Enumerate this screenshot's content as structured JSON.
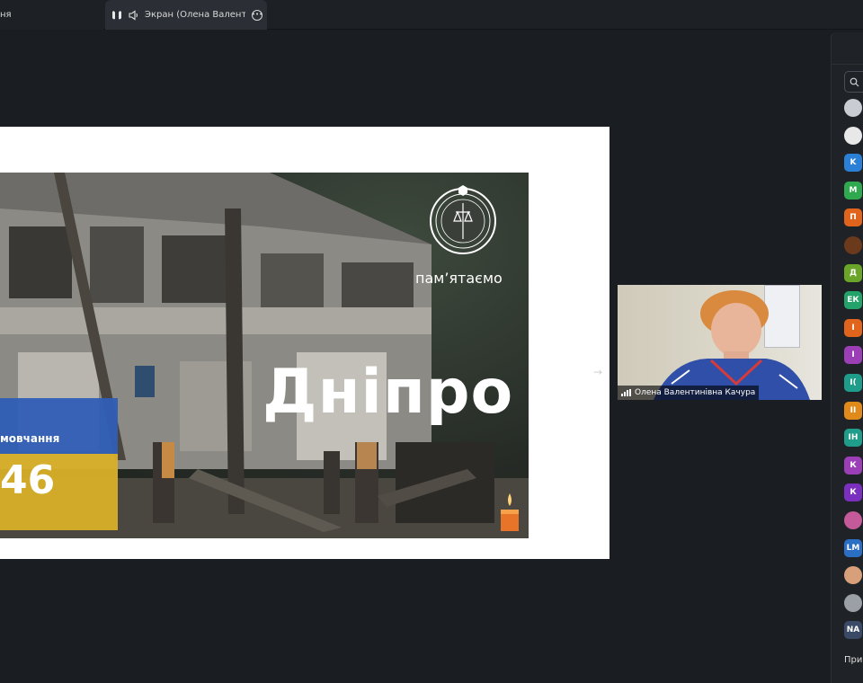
{
  "tabs": {
    "prev_label": "ня",
    "active_label": "Экран (Олена Валентинівна",
    "more_icon": "more-icon"
  },
  "slide": {
    "city_title": "Дніпро",
    "remember_text": "пам’ятаємо",
    "flag_label": "мовчання",
    "flag_number": "46"
  },
  "video": {
    "participant_name": "Олена Валентинівна Качура"
  },
  "panel": {
    "invite_label": "Приг",
    "participants": [
      {
        "kind": "image",
        "initials": "",
        "color": "#c9ccd2"
      },
      {
        "kind": "image",
        "initials": "",
        "color": "#e8e8e8"
      },
      {
        "kind": "text",
        "initials": "K",
        "color": "#2b7fd4"
      },
      {
        "kind": "text",
        "initials": "M",
        "color": "#2fa84f"
      },
      {
        "kind": "text",
        "initials": "П",
        "color": "#e0641b"
      },
      {
        "kind": "image",
        "initials": "",
        "color": "#6b3a1c"
      },
      {
        "kind": "text",
        "initials": "Д",
        "color": "#6aa52a"
      },
      {
        "kind": "text",
        "initials": "ЕК",
        "color": "#23a36a"
      },
      {
        "kind": "text",
        "initials": "І",
        "color": "#e0641b"
      },
      {
        "kind": "text",
        "initials": "І",
        "color": "#9c3fb6"
      },
      {
        "kind": "text",
        "initials": "І(",
        "color": "#1f9c8a"
      },
      {
        "kind": "text",
        "initials": "II",
        "color": "#e08a1b"
      },
      {
        "kind": "text",
        "initials": "ІН",
        "color": "#1f9c8a"
      },
      {
        "kind": "text",
        "initials": "К",
        "color": "#9c3fb6"
      },
      {
        "kind": "text",
        "initials": "К",
        "color": "#7b2fbf"
      },
      {
        "kind": "image",
        "initials": "",
        "color": "#c45a9a"
      },
      {
        "kind": "text",
        "initials": "LM",
        "color": "#2b6fc4"
      },
      {
        "kind": "image",
        "initials": "",
        "color": "#d8a07a"
      },
      {
        "kind": "image",
        "initials": "",
        "color": "#9aa0a6"
      },
      {
        "kind": "text",
        "initials": "NA",
        "color": "#3a4a66"
      }
    ]
  },
  "colors": {
    "background": "#1a1d21",
    "panel": "#1f2226",
    "flag_blue": "#2f5eb5",
    "flag_yellow": "#d9b028"
  }
}
